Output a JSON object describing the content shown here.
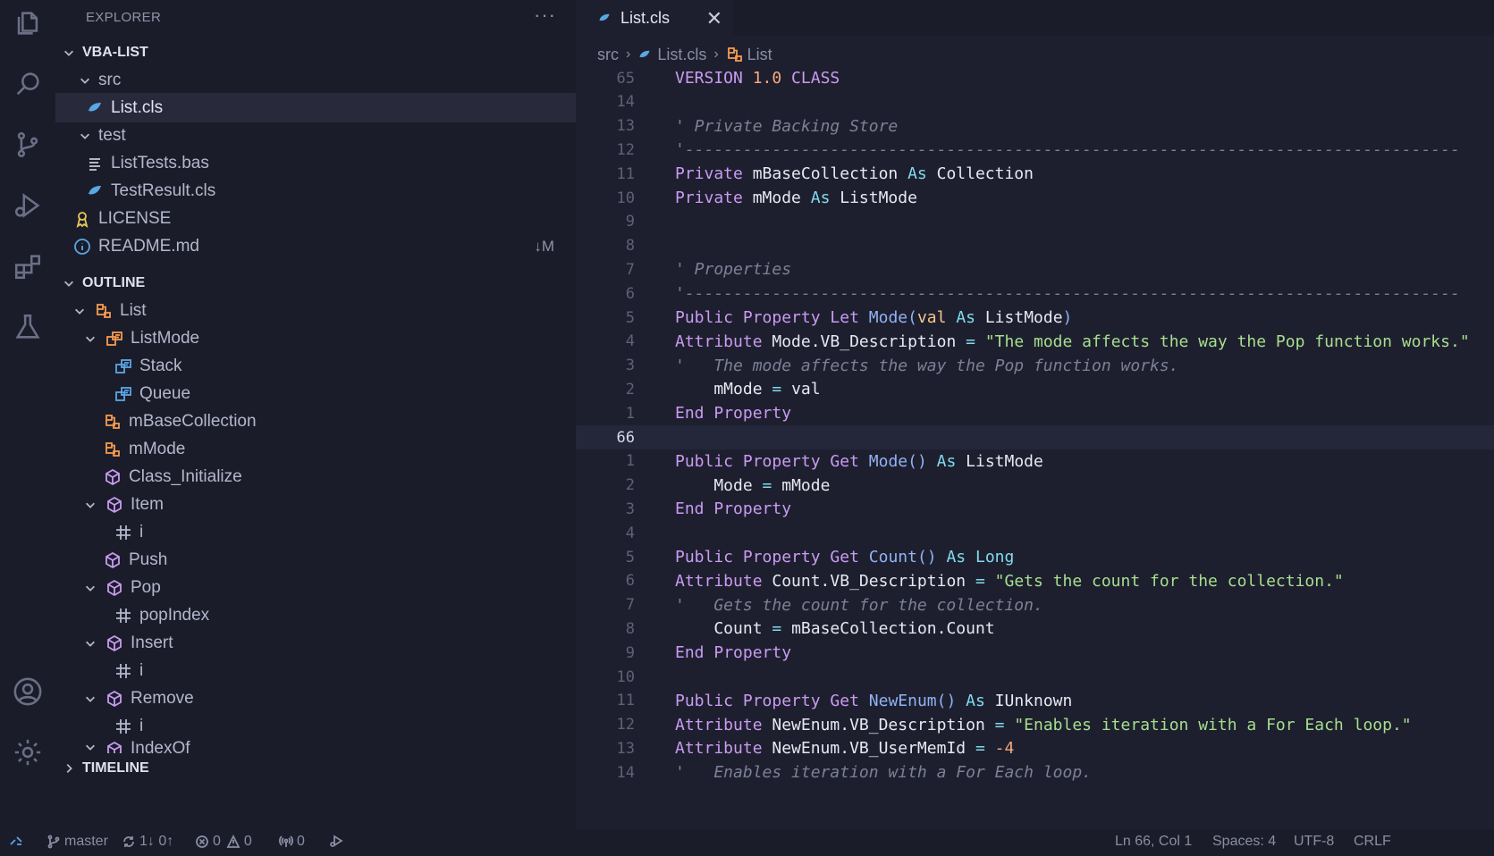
{
  "activity_bar": {
    "icons": [
      "files-icon",
      "search-icon",
      "source-control-icon",
      "run-debug-icon",
      "extensions-icon",
      "testing-icon",
      "account-icon",
      "settings-gear-icon"
    ]
  },
  "sidebar": {
    "title": "EXPLORER",
    "more_actions": "···",
    "workspace": "VBA-LIST",
    "tree": [
      {
        "label": "src",
        "indent": 1,
        "kind": "folder-open"
      },
      {
        "label": "List.cls",
        "indent": 2,
        "kind": "vba-file",
        "selected": true
      },
      {
        "label": "test",
        "indent": 1,
        "kind": "folder-open"
      },
      {
        "label": "ListTests.bas",
        "indent": 2,
        "kind": "text-file"
      },
      {
        "label": "TestResult.cls",
        "indent": 2,
        "kind": "vba-file"
      },
      {
        "label": "LICENSE",
        "indent": 1,
        "kind": "license-file"
      },
      {
        "label": "README.md",
        "indent": 1,
        "kind": "info-file",
        "badge": "↓M"
      }
    ],
    "outline_title": "OUTLINE",
    "outline": [
      {
        "label": "List"
      },
      {
        "label": "ListMode"
      },
      {
        "label": "Stack"
      },
      {
        "label": "Queue"
      },
      {
        "label": "mBaseCollection"
      },
      {
        "label": "mMode"
      },
      {
        "label": "Class_Initialize"
      },
      {
        "label": "Item"
      },
      {
        "label": "i"
      },
      {
        "label": "Push"
      },
      {
        "label": "Pop"
      },
      {
        "label": "popIndex"
      },
      {
        "label": "Insert"
      },
      {
        "label": "i"
      },
      {
        "label": "Remove"
      },
      {
        "label": "i"
      },
      {
        "label": "IndexOf"
      }
    ],
    "timeline_title": "TIMELINE"
  },
  "editor": {
    "tab_label": "List.cls",
    "tab_close": "✕",
    "breadcrumb": {
      "folder": "src",
      "file": "List.cls",
      "symbol": "List",
      "separator": "›"
    },
    "lines": [
      {
        "n": "65",
        "t": [
          [
            "VERSION ",
            "kw"
          ],
          [
            "1.0",
            "num"
          ],
          [
            " CLASS",
            "kw"
          ]
        ]
      },
      {
        "n": "14",
        "t": []
      },
      {
        "n": "13",
        "t": [
          [
            "' Private Backing Store",
            "cm"
          ]
        ]
      },
      {
        "n": "12",
        "t": [
          [
            "'--------------------------------------------------------------------------------",
            "cm"
          ]
        ]
      },
      {
        "n": "11",
        "t": [
          [
            "Private ",
            "kw"
          ],
          [
            "mBaseCollection ",
            "id"
          ],
          [
            "As ",
            "op"
          ],
          [
            "Collection",
            "id"
          ]
        ]
      },
      {
        "n": "10",
        "t": [
          [
            "Private ",
            "kw"
          ],
          [
            "mMode ",
            "id"
          ],
          [
            "As ",
            "op"
          ],
          [
            "ListMode",
            "id"
          ]
        ]
      },
      {
        "n": "9",
        "t": []
      },
      {
        "n": "8",
        "t": []
      },
      {
        "n": "7",
        "t": [
          [
            "' Properties",
            "cm"
          ]
        ]
      },
      {
        "n": "6",
        "t": [
          [
            "'--------------------------------------------------------------------------------",
            "cm"
          ]
        ]
      },
      {
        "n": "5",
        "t": [
          [
            "Public ",
            "kw"
          ],
          [
            "Property ",
            "kw"
          ],
          [
            "Let ",
            "kw"
          ],
          [
            "Mode",
            "fn"
          ],
          [
            "(",
            "par"
          ],
          [
            "val ",
            "vl"
          ],
          [
            "As ",
            "op"
          ],
          [
            "ListMode",
            "id"
          ],
          [
            ")",
            "par"
          ]
        ]
      },
      {
        "n": "4",
        "t": [
          [
            "Attribute ",
            "kw"
          ],
          [
            "Mode.VB_Description ",
            "id"
          ],
          [
            "= ",
            "op"
          ],
          [
            "\"The mode affects the way the Pop function works.\"",
            "str"
          ]
        ]
      },
      {
        "n": "3",
        "t": [
          [
            "'   The mode affects the way the Pop function works.",
            "cm"
          ]
        ]
      },
      {
        "n": "2",
        "t": [
          [
            "    mMode ",
            "id"
          ],
          [
            "= ",
            "op"
          ],
          [
            "val",
            "id"
          ]
        ]
      },
      {
        "n": "1",
        "t": [
          [
            "End ",
            "kw"
          ],
          [
            "Property",
            "kw"
          ]
        ]
      },
      {
        "n": "66",
        "t": [],
        "current": true
      },
      {
        "n": "1",
        "t": [
          [
            "Public ",
            "kw"
          ],
          [
            "Property ",
            "kw"
          ],
          [
            "Get ",
            "kw"
          ],
          [
            "Mode",
            "fn"
          ],
          [
            "() ",
            "par"
          ],
          [
            "As ",
            "op"
          ],
          [
            "ListMode",
            "id"
          ]
        ]
      },
      {
        "n": "2",
        "t": [
          [
            "    Mode ",
            "id"
          ],
          [
            "= ",
            "op"
          ],
          [
            "mMode",
            "id"
          ]
        ]
      },
      {
        "n": "3",
        "t": [
          [
            "End ",
            "kw"
          ],
          [
            "Property",
            "kw"
          ]
        ]
      },
      {
        "n": "4",
        "t": []
      },
      {
        "n": "5",
        "t": [
          [
            "Public ",
            "kw"
          ],
          [
            "Property ",
            "kw"
          ],
          [
            "Get ",
            "kw"
          ],
          [
            "Count",
            "fn"
          ],
          [
            "() ",
            "par"
          ],
          [
            "As ",
            "op"
          ],
          [
            "Long",
            "ty"
          ]
        ]
      },
      {
        "n": "6",
        "t": [
          [
            "Attribute ",
            "kw"
          ],
          [
            "Count.VB_Description ",
            "id"
          ],
          [
            "= ",
            "op"
          ],
          [
            "\"Gets the count for the collection.\"",
            "str"
          ]
        ]
      },
      {
        "n": "7",
        "t": [
          [
            "'   Gets the count for the collection.",
            "cm"
          ]
        ]
      },
      {
        "n": "8",
        "t": [
          [
            "    Count ",
            "id"
          ],
          [
            "= ",
            "op"
          ],
          [
            "mBaseCollection.Count",
            "id"
          ]
        ]
      },
      {
        "n": "9",
        "t": [
          [
            "End ",
            "kw"
          ],
          [
            "Property",
            "kw"
          ]
        ]
      },
      {
        "n": "10",
        "t": []
      },
      {
        "n": "11",
        "t": [
          [
            "Public ",
            "kw"
          ],
          [
            "Property ",
            "kw"
          ],
          [
            "Get ",
            "kw"
          ],
          [
            "NewEnum",
            "fn"
          ],
          [
            "() ",
            "par"
          ],
          [
            "As ",
            "op"
          ],
          [
            "IUnknown",
            "id"
          ]
        ]
      },
      {
        "n": "12",
        "t": [
          [
            "Attribute ",
            "kw"
          ],
          [
            "NewEnum.VB_Description ",
            "id"
          ],
          [
            "= ",
            "op"
          ],
          [
            "\"Enables iteration with a For Each loop.\"",
            "str"
          ]
        ]
      },
      {
        "n": "13",
        "t": [
          [
            "Attribute ",
            "kw"
          ],
          [
            "NewEnum.VB_UserMemId ",
            "id"
          ],
          [
            "= ",
            "op"
          ],
          [
            "-4",
            "num"
          ]
        ]
      },
      {
        "n": "14",
        "t": [
          [
            "'   Enables iteration with a For Each loop.",
            "cm"
          ]
        ]
      }
    ]
  },
  "status_bar": {
    "branch": "master",
    "sync": "1↓ 0↑",
    "errors": "0",
    "warnings": "0",
    "ports": "0",
    "position": "Ln 66, Col 1",
    "spaces": "Spaces: 4",
    "encoding": "UTF-8",
    "eol": "CRLF"
  },
  "colors": {
    "background": "#1e1f2e",
    "sidebar": "#1b1c29",
    "keyword": "#c99bf2",
    "string": "#a6df8f",
    "comment": "#7d8096",
    "number": "#f5a97f",
    "function": "#8fb3f5",
    "type": "#7fdcef",
    "vba_file_icon": "#5aa7e6",
    "enum_icon": "#f59b50",
    "method_icon": "#c99bf2"
  }
}
